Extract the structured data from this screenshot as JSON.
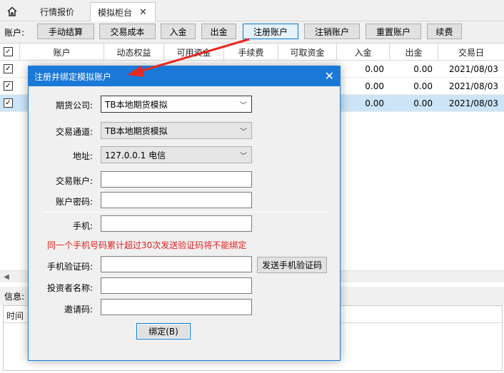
{
  "tabs": {
    "home_icon": "home-icon",
    "items": [
      {
        "label": "行情报价"
      },
      {
        "label": "模拟柜台"
      }
    ],
    "close_glyph": "✕"
  },
  "toolbar": {
    "label": "账户:",
    "buttons": [
      "手动结算",
      "交易成本",
      "入金",
      "出金",
      "注册账户",
      "注销账户",
      "重置账户",
      "续费"
    ]
  },
  "grid": {
    "columns": [
      "账户",
      "动态权益",
      "可用资金",
      "手续费",
      "可取资金",
      "入金",
      "出金",
      "交易日"
    ],
    "rows": [
      {
        "checked": true,
        "in": "0.00",
        "out": "0.00",
        "date": "2021/08/03"
      },
      {
        "checked": true,
        "in": "0.00",
        "out": "0.00",
        "date": "2021/08/03"
      },
      {
        "checked": true,
        "in": "0.00",
        "out": "0.00",
        "date": "2021/08/03",
        "selected": true
      }
    ],
    "check_glyph": "✓"
  },
  "info": {
    "label": "信息:",
    "log_column": "时间"
  },
  "dialog": {
    "title": "注册并绑定模拟账户",
    "close_glyph": "✕",
    "broker_label": "期货公司:",
    "broker_value": "TB本地期货模拟",
    "channel_label": "交易通道:",
    "channel_value": "TB本地期货模拟",
    "address_label": "地址:",
    "address_value": "127.0.0.1 电信",
    "account_label": "交易账户:",
    "password_label": "账户密码:",
    "phone_label": "手机:",
    "warning": "同一个手机号码累计超过30次发送验证码将不能绑定",
    "code_label": "手机验证码:",
    "send_code_button": "发送手机验证码",
    "investor_label": "投资者名称:",
    "invite_label": "邀请码:",
    "bind_button": "绑定(B)"
  },
  "colors": {
    "title_bar": "#1a78d7",
    "warning": "#e0201c",
    "arrow": "#e8291f",
    "selection": "#cce4f7"
  }
}
